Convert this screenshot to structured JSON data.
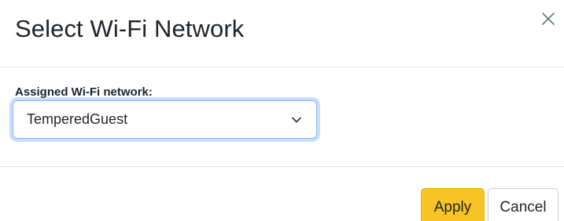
{
  "dialog": {
    "title": "Select Wi-Fi Network",
    "close_icon": "close-icon"
  },
  "form": {
    "label": "Assigned Wi-Fi network:",
    "selected_network": "TemperedGuest",
    "dropdown_icon": "chevron-down-icon"
  },
  "footer": {
    "apply_label": "Apply",
    "cancel_label": "Cancel"
  },
  "colors": {
    "apply_button": "#f8c325",
    "focus_ring": "#86b7fe",
    "divider": "#dee2e6"
  }
}
